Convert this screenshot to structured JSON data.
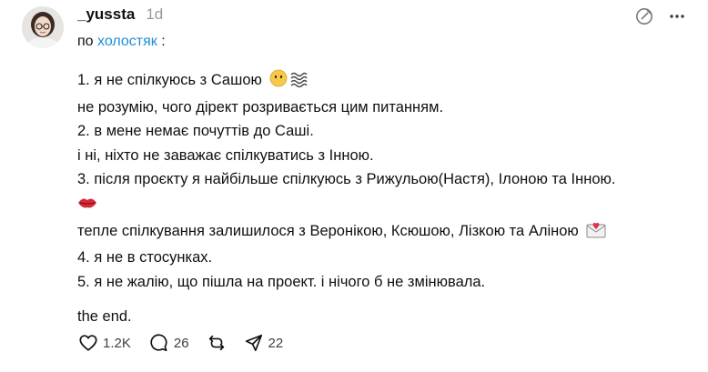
{
  "post": {
    "username": "_yussta",
    "timestamp": "1d",
    "topic_prefix": "по",
    "topic_link": "холостяк",
    "topic_suffix": ":",
    "lines": [
      "1. я не спілкуюсь з Сашою",
      "не розумію, чого дірект розривається цим питанням.",
      "2. в мене немає почуттів до Саші.",
      "і ні, ніхто не заважає спілкуватись з Інною.",
      "3. після проєкту я найбільше спілкуюсь з Рижульою(Настя), Ілоною та Інною.",
      "",
      "тепле спілкування залишилося з Веронікою, Ксюшою, Лізкою та Аліною",
      "4. я не в стосунках.",
      "5. я не жалію, що пішла на проект. і нічого б не змінювала."
    ],
    "ending": "the end."
  },
  "stats": {
    "likes": "1.2K",
    "comments": "26",
    "shares": "22"
  },
  "icons": {
    "like": "heart-icon",
    "comment": "comment-bubble-icon",
    "repost": "repost-icon",
    "share": "send-icon",
    "top_left": "no-reply-icon",
    "top_right": "more-icon"
  }
}
